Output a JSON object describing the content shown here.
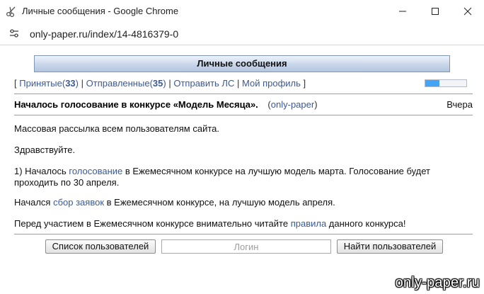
{
  "window": {
    "title": "Личные сообщения - Google Chrome",
    "url": "only-paper.ru/index/14-4816379-0"
  },
  "page": {
    "header_title": "Личные сообщения",
    "nav": {
      "inbox_label": "Принятые",
      "inbox_count": "33",
      "sent_label": "Отправленные",
      "sent_count": "35",
      "send_label": "Отправить ЛС",
      "profile_label": "Мой профиль",
      "bracket_open": "[",
      "bracket_close": "]",
      "separator": "|",
      "count_open": "(",
      "count_close": ")"
    },
    "storage_fill_fraction": 0.35,
    "message": {
      "subject": "Началось голосование в конкурсе «Модель Месяца».",
      "sender_open": "(",
      "sender": "only-paper",
      "sender_close": ")",
      "date": "Вчера",
      "line1": "Массовая рассылка всем пользователям сайта.",
      "line2": "Здравствуйте.",
      "p3_before": "1) Началось ",
      "p3_link": "голосование",
      "p3_after": " в Ежемесячном конкурсе на лучшую модель марта. Голосование будет проходить по 30 апреля.",
      "p4_before": "Начался ",
      "p4_link": "сбор заявок",
      "p4_after": " в Ежемесячном конкурсе, на лучшую модель апреля.",
      "p5_before": "Перед участием в Ежемесячном конкурсе внимательно читайте ",
      "p5_link": "правила",
      "p5_after": " данного конкурса!"
    },
    "user_list_button": "Список пользователей",
    "login_placeholder": "Логин",
    "find_button": "Найти пользователей"
  },
  "watermark": "only-paper.ru",
  "colors": {
    "link": "#3b5998",
    "progress_fill": "#42a5f5",
    "header_gradient_bottom": "#b4c5e0"
  }
}
